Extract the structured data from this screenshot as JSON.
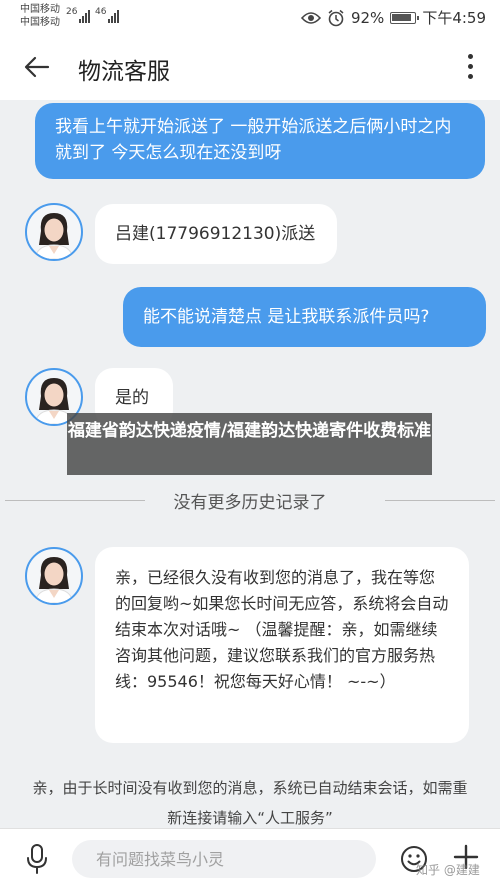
{
  "status_bar": {
    "carrier_1": "中国移动",
    "carrier_2": "中国移动",
    "network_1": "26",
    "network_2": "46",
    "battery": "92%",
    "time": "下午4:59"
  },
  "header": {
    "title": "物流客服"
  },
  "messages": [
    {
      "from": "user",
      "text": "我看上午就开始派送了 一般开始派送之后俩小时之内就到了 今天怎么现在还没到呀"
    },
    {
      "from": "agent",
      "text": "吕建(17796912130)派送"
    },
    {
      "from": "user",
      "text": "能不能说清楚点 是让我联系派件员吗?"
    },
    {
      "from": "agent",
      "text": "是的"
    },
    {
      "from": "agent",
      "text": "亲，已经很久没有收到您的消息了，我在等您的回复哟~如果您长时间无应答，系统将会自动结束本次对话哦~ （温馨提醒：亲，如需继续咨询其他问题，建议您联系我们的官方服务热线：95546！祝您每天好心情！ ~-~）"
    }
  ],
  "history_divider": "没有更多历史记录了",
  "system_message": "亲，由于长时间没有收到您的消息，系统已自动结束会话，如需重新连接请输入“人工服务”",
  "watermark": "福建省韵达快递疫情/福建韵达快递寄件收费标准",
  "input_bar": {
    "placeholder": "有问题找菜鸟小灵"
  },
  "source_watermark": "知乎 @建建",
  "colors": {
    "accent": "#4a9bec",
    "background": "#eef0f2"
  }
}
